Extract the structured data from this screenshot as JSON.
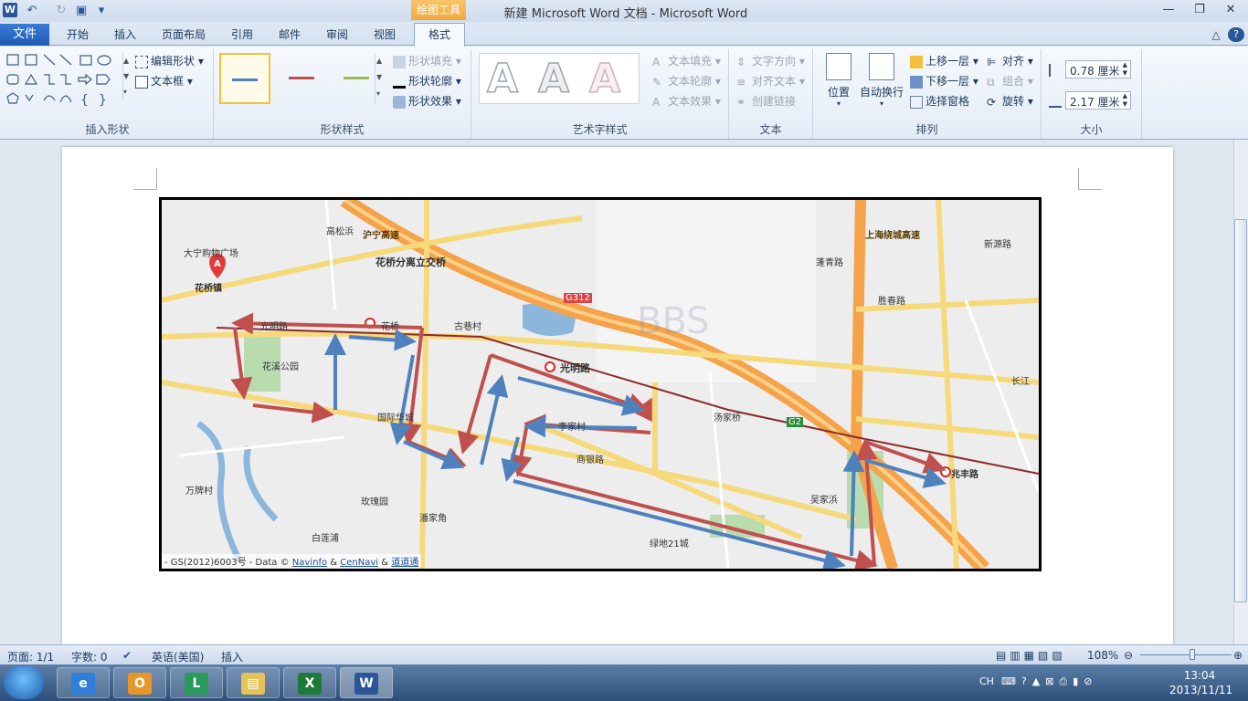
{
  "titlebar": {
    "logo": "W",
    "undo": "↶",
    "redo": "↻",
    "save": "▣",
    "qa_more": "▾",
    "context_tab": "绘图工具",
    "title": "新建 Microsoft Word 文档 - Microsoft Word",
    "minimize": "—",
    "restore": "❐",
    "close": "✕"
  },
  "tabs": {
    "file": "文件",
    "items": [
      "开始",
      "插入",
      "页面布局",
      "引用",
      "邮件",
      "审阅",
      "视图"
    ],
    "active": "格式",
    "collapse": "△",
    "help": "?"
  },
  "ribbon": {
    "insert_shape": {
      "label": "插入形状",
      "edit_shape": "编辑形状",
      "text_box": "文本框"
    },
    "shape_styles": {
      "label": "形状样式",
      "fill": "形状填充",
      "outline": "形状轮廓",
      "effects": "形状效果",
      "swatches": [
        "#4f81bd",
        "#c0504d",
        "#9bbb59"
      ]
    },
    "wordart": {
      "label": "艺术字样式",
      "glyph": "A",
      "text_fill": "文本填充",
      "text_outline": "文本轮廓",
      "text_effects": "文本效果"
    },
    "text": {
      "label": "文本",
      "direction": "文字方向",
      "align": "对齐文本",
      "link": "创建链接"
    },
    "arrange": {
      "label": "排列",
      "position": "位置",
      "wrap": "自动换行",
      "forward": "上移一层",
      "backward": "下移一层",
      "selection": "选择窗格",
      "align": "对齐",
      "group": "组合",
      "rotate": "旋转"
    },
    "size": {
      "label": "大小",
      "height": "0.78 厘米",
      "width": "2.17 厘米"
    }
  },
  "map": {
    "labels": {
      "dana": "大宁购物广场",
      "huaqiao": "花桥镇",
      "gaosong": "高松浜",
      "huaqiao_interchange": "花桥分离立交桥",
      "hutong": "沪宁高速",
      "huaqiao_station": "花桥",
      "guangming_rd": "光明路",
      "guxiang": "古巷村",
      "huaxi_park": "花溪公园",
      "guoji": "国际华城",
      "zhaofeng": "兆丰路",
      "guangming": "光明路",
      "tangjia": "汤家桥",
      "lijia": "李家村",
      "shangyin": "商银路",
      "wanyi": "万牌村",
      "meigui": "玫瑰园",
      "panjia": "潘家角",
      "baiya": "白莲浦",
      "wujia": "吴家浜",
      "lvdi": "绿地21城",
      "penqing": "蓬青路",
      "shengsheng": "胜春路",
      "xinyuan": "新源路",
      "changjiang": "长江",
      "shanghai_ring": "上海绕城高速",
      "g312": "G312",
      "g2": "G2",
      "marker": "A",
      "watermark": "BBS"
    },
    "copyright_prefix": "- GS(2012)6003号 - Data ©",
    "navinfo": "Navinfo",
    "amp": "&",
    "cennavi": "CenNavi",
    "daodao": "道道通",
    "colors": {
      "route_red": "#c0504d",
      "route_blue": "#4f81bd"
    }
  },
  "status": {
    "page": "页面: 1/1",
    "words": "字数: 0",
    "lang": "英语(美国)",
    "mode": "插入",
    "zoom": "108%",
    "zoom_level": 0.54
  },
  "taskbar": {
    "ime": "CH",
    "time": "13:04",
    "date": "2013/11/11",
    "apps": [
      "e",
      "O",
      "L",
      "▤",
      "X",
      "W"
    ]
  }
}
